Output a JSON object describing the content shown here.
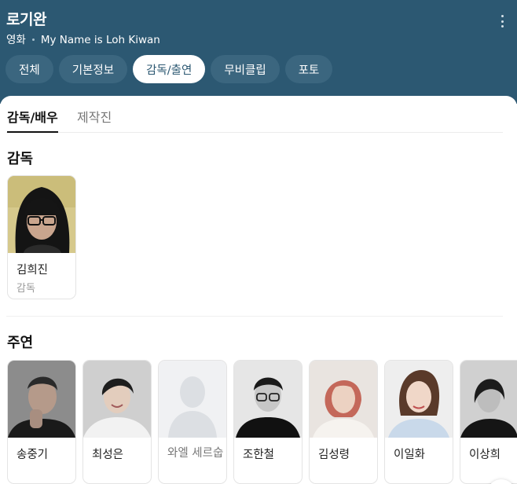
{
  "header": {
    "title": "로기완",
    "category": "영화",
    "english_title": "My Name is Loh Kiwan",
    "more_icon": "more-vertical-icon"
  },
  "tabs": [
    {
      "label": "전체",
      "active": false
    },
    {
      "label": "기본정보",
      "active": false
    },
    {
      "label": "감독/출연",
      "active": true
    },
    {
      "label": "무비클립",
      "active": false
    },
    {
      "label": "포토",
      "active": false
    }
  ],
  "subtabs": [
    {
      "label": "감독/배우",
      "active": true
    },
    {
      "label": "제작진",
      "active": false
    }
  ],
  "director_section": {
    "title": "감독",
    "people": [
      {
        "name": "김희진",
        "role": "감독"
      }
    ]
  },
  "lead_section": {
    "title": "주연",
    "people": [
      {
        "name": "송중기"
      },
      {
        "name": "최성은"
      },
      {
        "name": "와엘 세르숩",
        "no_photo": true
      },
      {
        "name": "조한철"
      },
      {
        "name": "김성령"
      },
      {
        "name": "이일화"
      },
      {
        "name": "이상희"
      }
    ],
    "next_icon": "chevron-right-icon"
  },
  "colors": {
    "header_bg": "#2c5872",
    "tab_bg": "#3b667f",
    "active_tab_text": "#2c5872"
  }
}
